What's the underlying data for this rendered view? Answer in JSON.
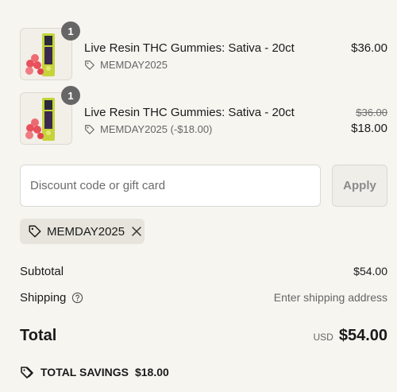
{
  "line_items": [
    {
      "title": "Live Resin THC Gummies: Sativa - 20ct",
      "quantity": "1",
      "discount": "MEMDAY2025",
      "price": "$36.00",
      "original_price": ""
    },
    {
      "title": "Live Resin THC Gummies: Sativa - 20ct",
      "quantity": "1",
      "discount": "MEMDAY2025 (-$18.00)",
      "price": "$18.00",
      "original_price": "$36.00"
    }
  ],
  "discount_form": {
    "placeholder": "Discount code or gift card",
    "value": "",
    "apply_label": "Apply"
  },
  "applied_code": {
    "code": "MEMDAY2025",
    "icon": "tag-icon",
    "remove_icon": "close-icon"
  },
  "summary": {
    "subtotal_label": "Subtotal",
    "subtotal_value": "$54.00",
    "shipping_label": "Shipping",
    "shipping_value": "Enter shipping address",
    "total_label": "Total",
    "currency": "USD",
    "total_value": "$54.00",
    "savings_label": "TOTAL SAVINGS",
    "savings_value": "$18.00"
  },
  "colors": {
    "background": "#f6f5f0",
    "badge": "#666666",
    "chip": "#e6e4dc",
    "product_accent": "#c6d33a",
    "gummy": "#e8505b"
  }
}
